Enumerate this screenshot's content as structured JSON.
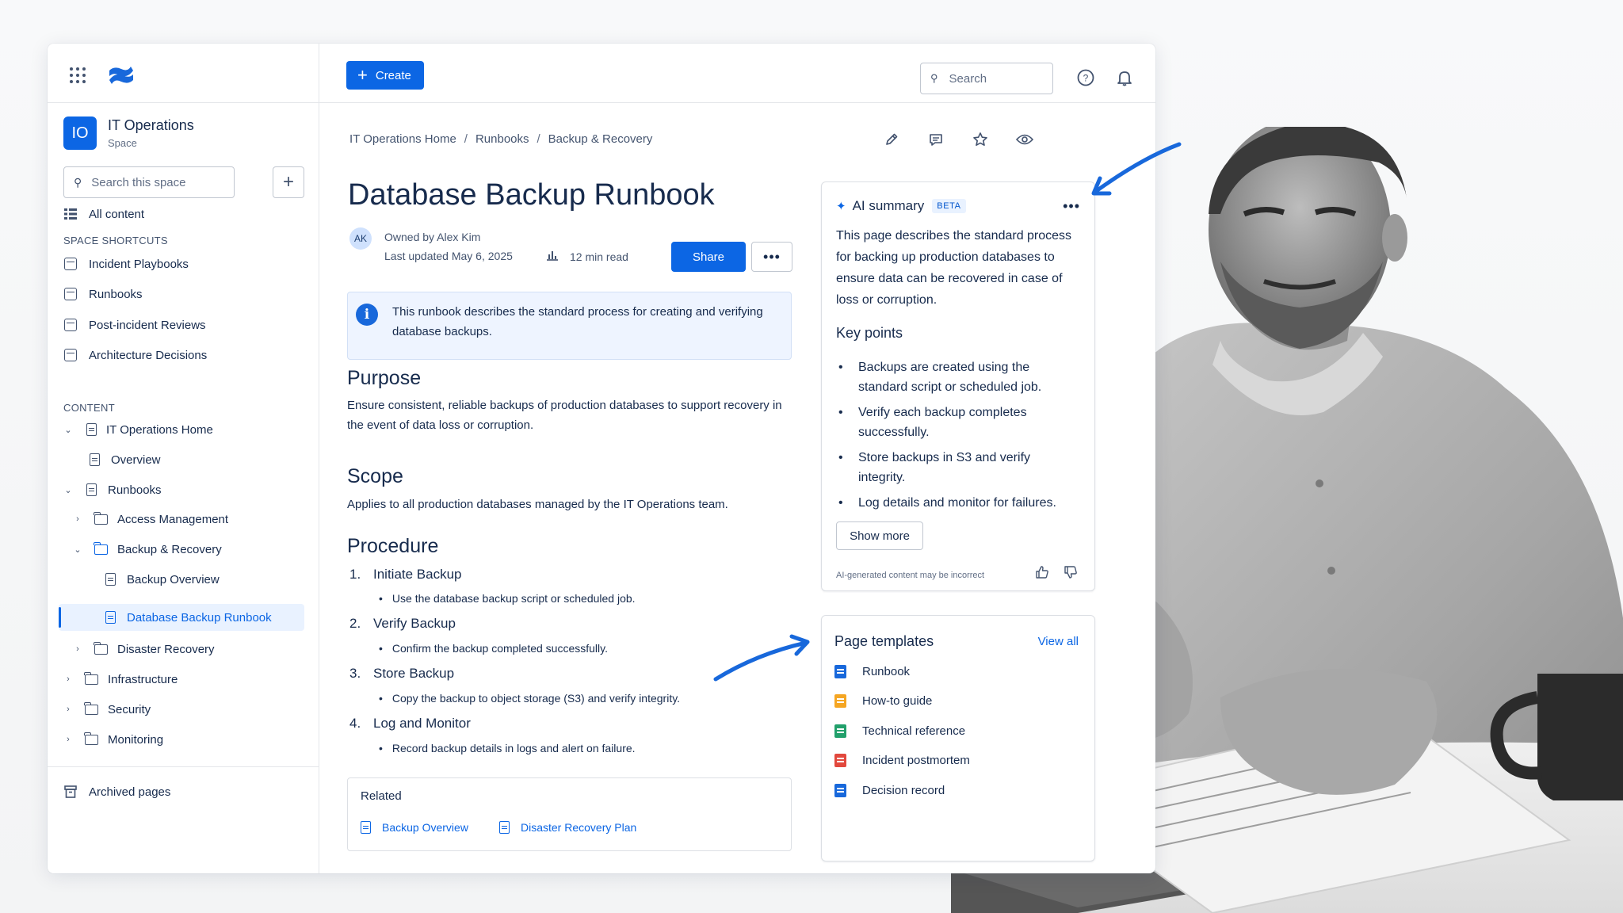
{
  "topbar": {
    "create_label": "Create",
    "search_placeholder": "Search",
    "avatar_initials": "AK"
  },
  "sidebar": {
    "space_initials": "IO",
    "space_name": "IT Operations",
    "space_type": "Space",
    "search_placeholder": "Search this space",
    "all_content": "All content",
    "shortcuts_label": "SPACE SHORTCUTS",
    "shortcuts": [
      "Incident Playbooks",
      "Runbooks",
      "Post-incident Reviews",
      "Architecture Decisions"
    ],
    "content_label": "CONTENT",
    "tree": {
      "it_ops_home": "IT Operations Home",
      "overview": "Overview",
      "runbooks": "Runbooks",
      "access_management": "Access Management",
      "backup_recovery": "Backup & Recovery",
      "backup_overview": "Backup Overview",
      "db_backup_runbook": "Database Backup Runbook",
      "disaster_recovery": "Disaster Recovery",
      "infrastructure": "Infrastructure",
      "security": "Security",
      "monitoring": "Monitoring"
    },
    "archived": "Archived pages"
  },
  "breadcrumb": [
    "IT Operations Home",
    "Runbooks",
    "Backup & Recovery"
  ],
  "page": {
    "title": "Database Backup Runbook",
    "author_initials": "AK",
    "owner": "Owned by Alex Kim",
    "updated": "Last updated May 6, 2025",
    "read_time": "12 min read",
    "share_label": "Share",
    "more_label": "•••",
    "info": "This runbook describes the standard process for creating and verifying database backups.",
    "purpose_heading": "Purpose",
    "purpose_text": "Ensure consistent, reliable backups of production databases to support recovery in the event of data loss or corruption.",
    "scope_heading": "Scope",
    "scope_text": "Applies to all production databases managed by the IT Operations team.",
    "procedure_heading": "Procedure",
    "steps": [
      {
        "num": "1.",
        "title": "Initiate Backup",
        "detail": "Use the database backup script or scheduled job."
      },
      {
        "num": "2.",
        "title": "Verify Backup",
        "detail": "Confirm the backup completed successfully."
      },
      {
        "num": "3.",
        "title": "Store Backup",
        "detail": "Copy the backup to object storage (S3) and verify integrity."
      },
      {
        "num": "4.",
        "title": "Log and Monitor",
        "detail": "Record backup details in logs and alert on failure."
      }
    ],
    "related_label": "Related",
    "related_links": [
      "Backup Overview",
      "Disaster Recovery Plan"
    ]
  },
  "ai_summary": {
    "title": "AI summary",
    "badge": "BETA",
    "more_label": "•••",
    "description": "This page describes the standard process for backing up production databases to ensure data can be recovered in case of loss or corruption.",
    "key_points_label": "Key points",
    "key_points": [
      "Backups are created using the standard script or scheduled job.",
      "Verify each backup completes successfully.",
      "Store backups in S3 and verify integrity.",
      "Log details and monitor for failures."
    ],
    "show_more": "Show more",
    "disclaimer": "AI-generated content may be incorrect"
  },
  "templates": {
    "title": "Page templates",
    "view_all": "View all",
    "items": [
      {
        "label": "Runbook",
        "color": "#1868db"
      },
      {
        "label": "How-to guide",
        "color": "#f5a623"
      },
      {
        "label": "Technical reference",
        "color": "#22a06b"
      },
      {
        "label": "Incident postmortem",
        "color": "#e2483d"
      },
      {
        "label": "Decision record",
        "color": "#1868db"
      }
    ]
  },
  "colors": {
    "accent": "#0c66e4",
    "arrow": "#1868db"
  }
}
